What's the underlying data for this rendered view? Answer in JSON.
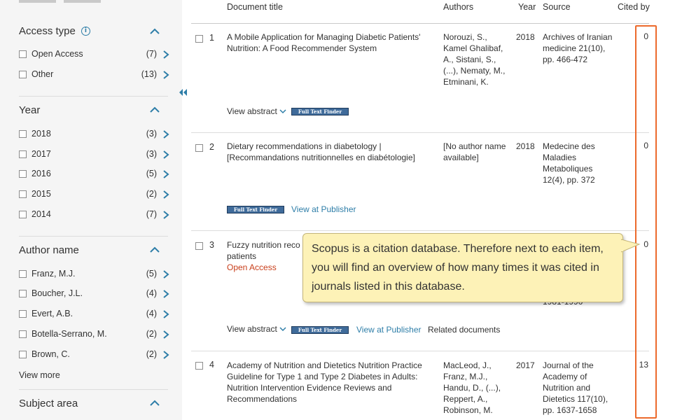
{
  "sidebar": {
    "access_type": {
      "title": "Access type",
      "items": [
        {
          "label": "Open Access",
          "count": "(7)"
        },
        {
          "label": "Other",
          "count": "(13)"
        }
      ]
    },
    "year": {
      "title": "Year",
      "items": [
        {
          "label": "2018",
          "count": "(3)"
        },
        {
          "label": "2017",
          "count": "(3)"
        },
        {
          "label": "2016",
          "count": "(5)"
        },
        {
          "label": "2015",
          "count": "(2)"
        },
        {
          "label": "2014",
          "count": "(7)"
        }
      ]
    },
    "author_name": {
      "title": "Author name",
      "items": [
        {
          "label": "Franz, M.J.",
          "count": "(5)"
        },
        {
          "label": "Boucher, J.L.",
          "count": "(4)"
        },
        {
          "label": "Evert, A.B.",
          "count": "(4)"
        },
        {
          "label": "Botella-Serrano, M.",
          "count": "(2)"
        },
        {
          "label": "Brown, C.",
          "count": "(2)"
        }
      ]
    },
    "view_more": "View more",
    "subject_area": {
      "title": "Subject area"
    }
  },
  "table": {
    "headers": {
      "title": "Document title",
      "authors": "Authors",
      "year": "Year",
      "source": "Source",
      "cited_by": "Cited by"
    },
    "rows": [
      {
        "num": "1",
        "title": "A Mobile Application for Managing Diabetic Patients' Nutrition: A Food Recommender System",
        "authors": "Norouzi, S., Kamel Ghalibaf, A., Sistani, S., (...), Nematy, M., Etminani, K.",
        "year": "2018",
        "source": "Archives of Iranian medicine 21(10), pp. 466-472",
        "cited": "0"
      },
      {
        "num": "2",
        "title": "Dietary recommendations in diabetology | [Recommandations nutritionnelles en diabétologie]",
        "authors": "[No author name available]",
        "year": "2018",
        "source": "Medecine des Maladies Metaboliques 12(4), pp. 372",
        "cited": "0"
      },
      {
        "num": "3",
        "title": "Fuzzy nutrition reco",
        "title_cont": "patients",
        "open_access": "Open Access",
        "source_partial": "1981-1990",
        "cited": "0"
      },
      {
        "num": "4",
        "title": "Academy of Nutrition and Dietetics Nutrition Practice Guideline for Type 1 and Type 2 Diabetes in Adults: Nutrition Intervention Evidence Reviews and Recommendations",
        "authors": "MacLeod, J., Franz, M.J., Handu, D., (...), Reppert, A., Robinson, M.",
        "year": "2017",
        "source": "Journal of the Academy of Nutrition and Dietetics 117(10), pp. 1637-1658",
        "cited": "13"
      }
    ],
    "actions": {
      "view_abstract": "View abstract",
      "full_text_finder": "Full Text Finder",
      "view_at_publisher": "View at Publisher",
      "related_documents": "Related documents"
    }
  },
  "tooltip": {
    "text": "Scopus is a citation database. Therefore next to each item, you will find an overview of how many times it was cited in journals listed in this database."
  },
  "colors": {
    "accent": "#2e7ea8",
    "highlight": "#ec6a2c",
    "open_access": "#c83e1a",
    "tooltip_bg": "#fdf2b7"
  }
}
